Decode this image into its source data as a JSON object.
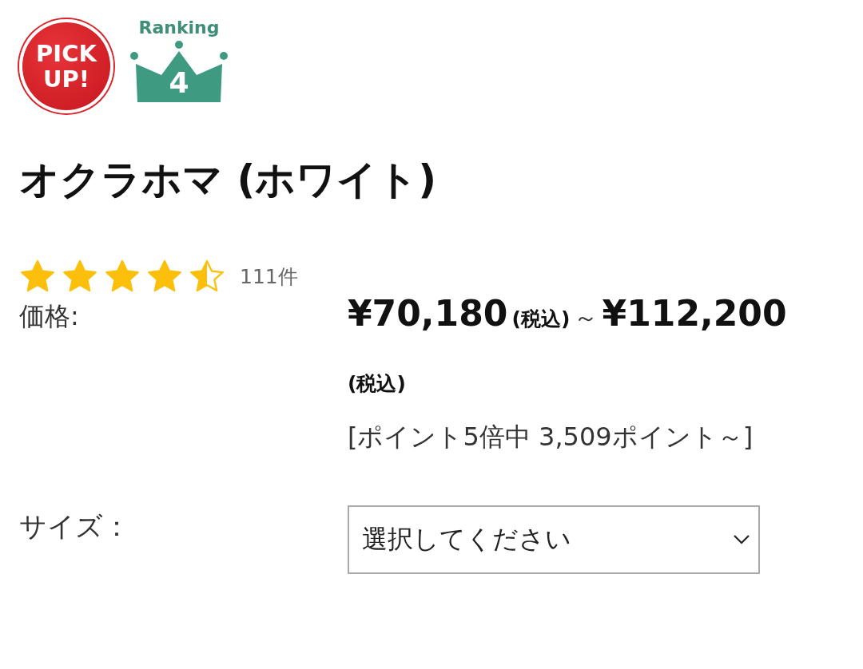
{
  "badges": {
    "pickup": {
      "lines": [
        "PICK",
        "UP!"
      ]
    },
    "ranking": {
      "label": "Ranking",
      "rank": "4"
    }
  },
  "product": {
    "title": "オクラホマ (ホワイト)"
  },
  "rating": {
    "stars": 4.5,
    "count": "111件"
  },
  "price": {
    "label": "価格:",
    "from": "¥70,180",
    "tax_note_from": "(税込)",
    "separator": "～",
    "to": "¥112,200",
    "tax_note_to": "(税込)",
    "points": "[ポイント5倍中 3,509ポイント～]"
  },
  "size": {
    "label": "サイズ：",
    "select": {
      "placeholder": "選択してください"
    }
  }
}
